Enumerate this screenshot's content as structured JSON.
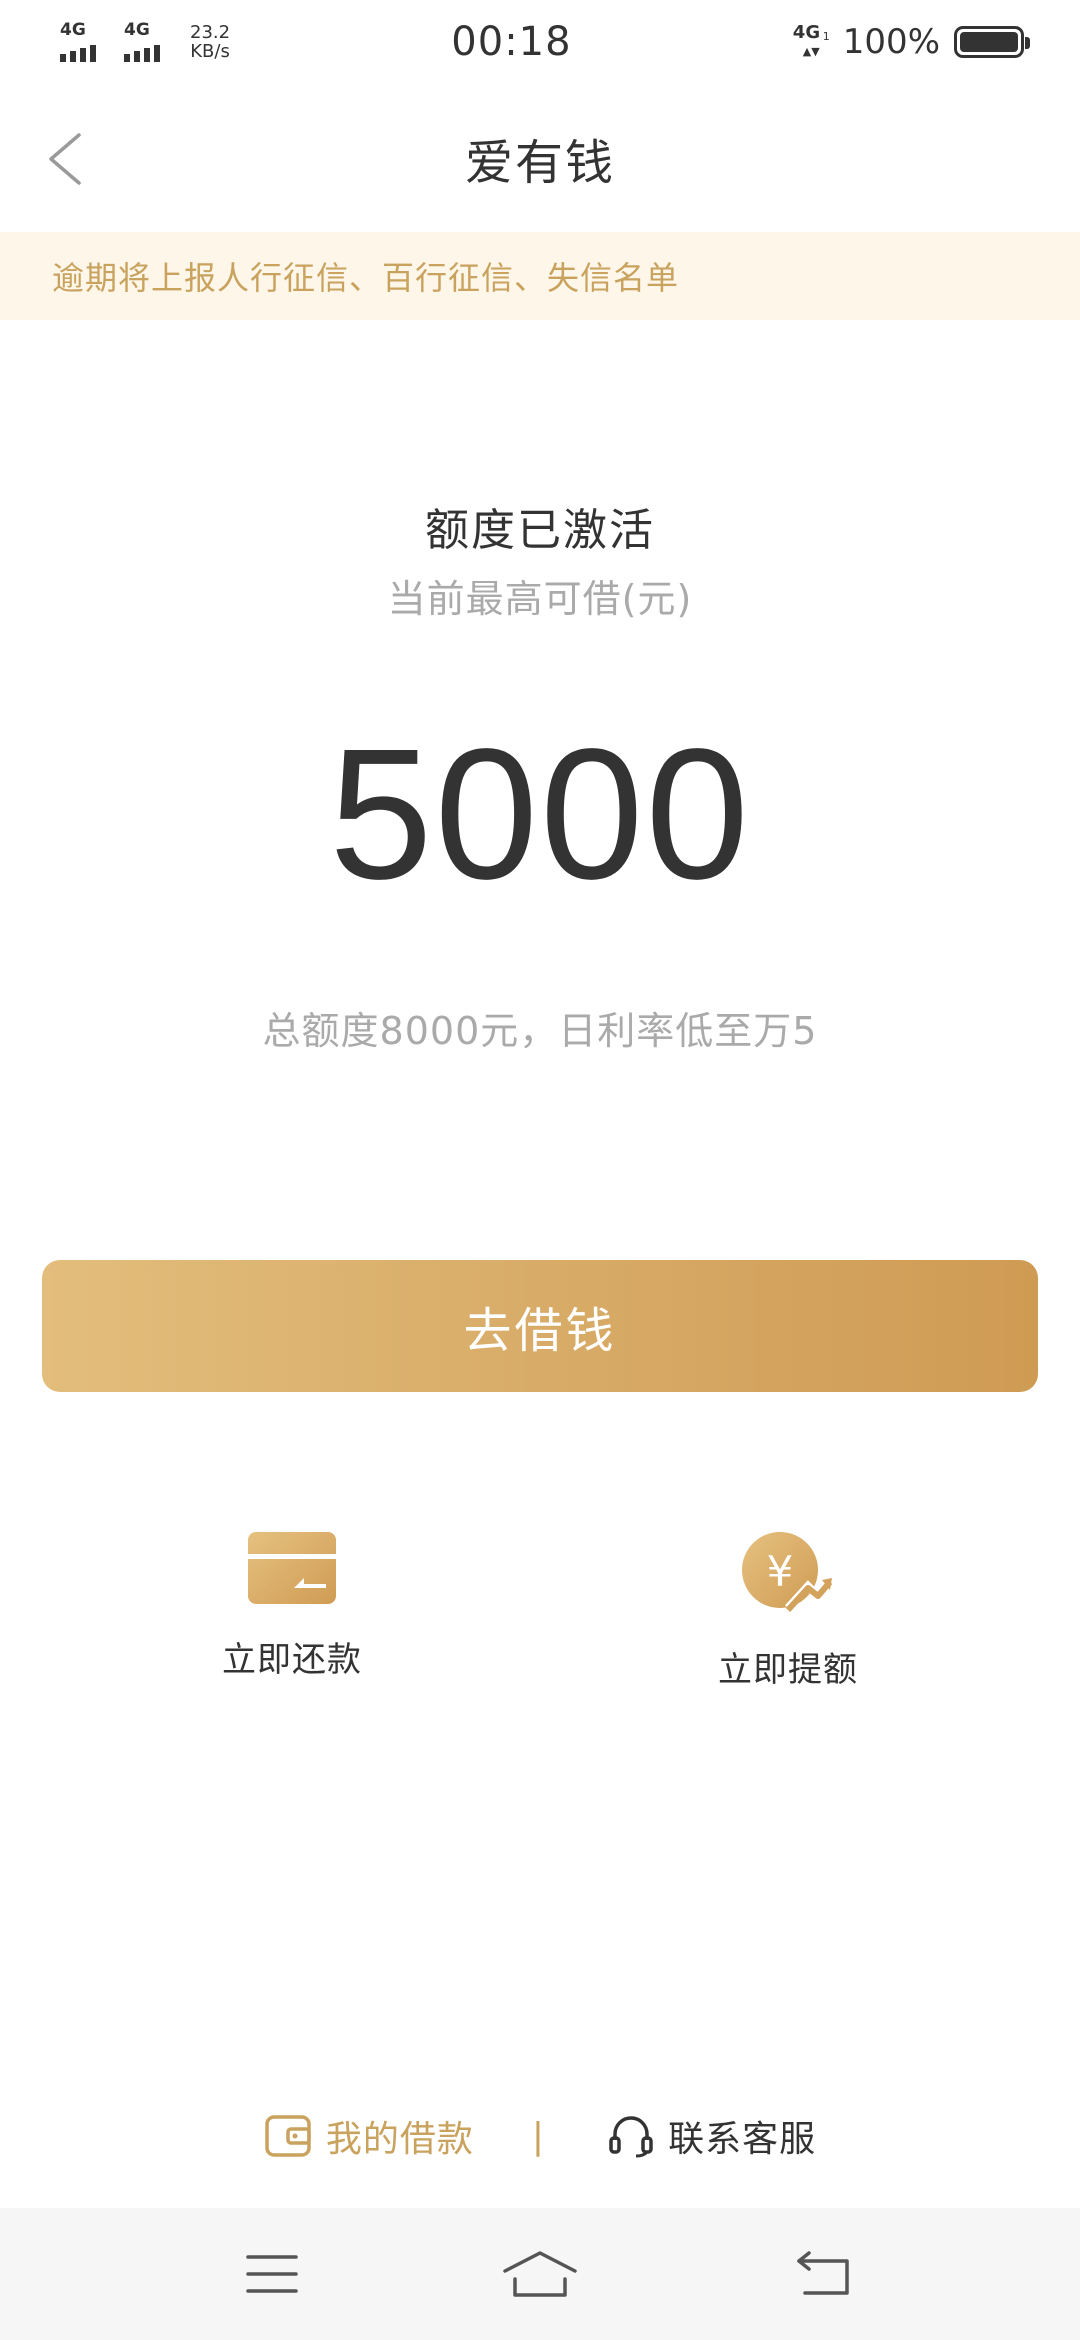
{
  "status_bar": {
    "sim1_type": "4G",
    "sim2_type": "4G",
    "net_speed_value": "23.2",
    "net_speed_unit": "KB/s",
    "time": "00:18",
    "data_type": "4G",
    "data_sub": "1",
    "battery": "100%"
  },
  "header": {
    "title": "爱有钱",
    "back_icon": "chevron-left-icon"
  },
  "notice": {
    "text": "逾期将上报人行征信、百行征信、失信名单"
  },
  "quota": {
    "status": "额度已激活",
    "caption": "当前最高可借(元)",
    "amount": "5000",
    "description": "总额度8000元，日利率低至万5"
  },
  "borrow_button": {
    "label": "去借钱"
  },
  "actions": [
    {
      "label": "立即还款",
      "icon": "wallet-card-icon"
    },
    {
      "label": "立即提额",
      "icon": "yuan-coin-arrow-icon"
    }
  ],
  "footer": {
    "my_loans": "我的借款",
    "divider": "|",
    "contact_service": "联系客服"
  },
  "nav_bar": {
    "menu_icon": "menu-icon",
    "home_icon": "home-icon",
    "back_icon": "back-arrow-icon"
  },
  "colors": {
    "accent_gold": "#c9a25d",
    "button_gradient_start": "#e3bd7c",
    "button_gradient_end": "#cf9b54",
    "notice_bg": "#fdf6e9",
    "text_primary": "#333333",
    "text_secondary": "#aaaaaa",
    "nav_bg": "#f6f6f6"
  }
}
